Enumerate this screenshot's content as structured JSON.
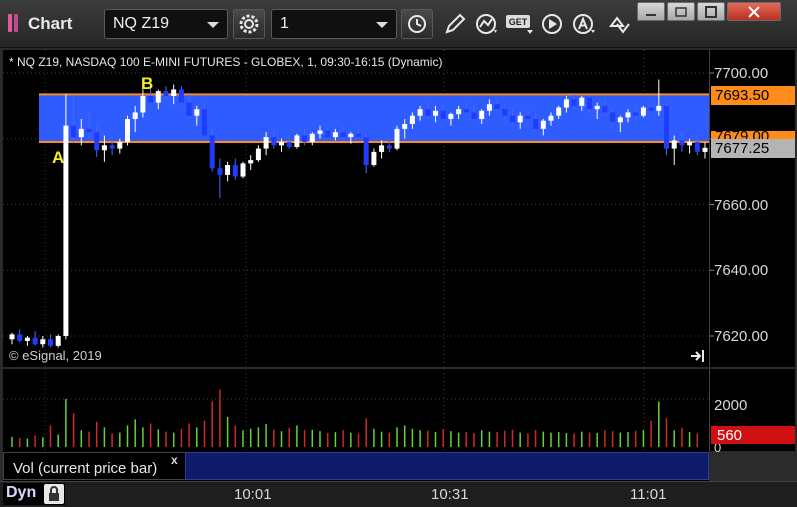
{
  "window": {
    "title": "Chart",
    "symbol": "NQ Z19",
    "interval": "1"
  },
  "chart_info": {
    "header": "* NQ Z19, NASDAQ 100 E-MINI FUTURES - GLOBEX, 1, 09:30-16:15 (Dynamic)",
    "copyright": "© eSignal, 2019",
    "label_a": "A",
    "label_b": "B"
  },
  "colors": {
    "up_candle": "#ffffff",
    "down_candle": "#1f3cff",
    "zone_fill": "#2f5cff",
    "zone_line": "#ff8c1a",
    "current_price_tag": "#b4b4b4",
    "upper_price_tag": "#ff8c1a",
    "volume_up": "#64d23c",
    "volume_down": "#d22828",
    "volume_tag": "#d01010"
  },
  "price_axis": {
    "ticks": [
      "7700.00",
      "7680.00",
      "7660.00",
      "7640.00",
      "7620.00"
    ],
    "upper_zone_tag": "7693.50",
    "lower_zone_tag": "7679.00",
    "current_price_tag": "7677.25"
  },
  "volume_panel": {
    "legend": "Vol (current price bar)",
    "close_symbol": "x",
    "axis_ticks": [
      "2000",
      "0"
    ],
    "current_volume_tag": "560"
  },
  "time_axis": {
    "dyn_label": "Dyn",
    "ticks": [
      "10:01",
      "10:31",
      "11:01"
    ]
  },
  "chart_data": {
    "type": "candlestick",
    "title": "* NQ Z19, NASDAQ 100 E-MINI FUTURES - GLOBEX, 1, 09:30-16:15 (Dynamic)",
    "y_axis_ticks": [
      7620,
      7640,
      7660,
      7680,
      7700
    ],
    "x_axis_ticks": [
      "10:01",
      "10:31",
      "11:01"
    ],
    "ylim": [
      7616,
      7707
    ],
    "zone": {
      "top": 7693.5,
      "bottom": 7679,
      "left_label": "A",
      "right_label": "B"
    },
    "last_price": 7677.25,
    "ohlc": [
      [
        7619.0,
        7621.0,
        7617.5,
        7620.5
      ],
      [
        7620.5,
        7622.0,
        7618.0,
        7618.5
      ],
      [
        7618.5,
        7620.0,
        7617.0,
        7619.5
      ],
      [
        7619.5,
        7621.5,
        7617.0,
        7617.5
      ],
      [
        7617.5,
        7620.0,
        7616.5,
        7619.0
      ],
      [
        7619.0,
        7620.5,
        7616.5,
        7617.0
      ],
      [
        7617.0,
        7620.5,
        7616.5,
        7620.0
      ],
      [
        7620.0,
        7693.5,
        7619.0,
        7684.0
      ],
      [
        7684.0,
        7693.0,
        7679.0,
        7680.5
      ],
      [
        7680.5,
        7686.0,
        7678.0,
        7683.0
      ],
      [
        7683.0,
        7688.0,
        7680.0,
        7682.0
      ],
      [
        7682.0,
        7684.0,
        7674.5,
        7676.5
      ],
      [
        7676.5,
        7681.0,
        7673.0,
        7678.0
      ],
      [
        7678.0,
        7681.0,
        7675.0,
        7677.0
      ],
      [
        7677.0,
        7680.0,
        7675.5,
        7679.0
      ],
      [
        7679.0,
        7687.0,
        7678.0,
        7686.0
      ],
      [
        7686.0,
        7690.0,
        7682.0,
        7688.0
      ],
      [
        7688.0,
        7695.0,
        7686.5,
        7693.0
      ],
      [
        7693.0,
        7697.0,
        7690.0,
        7691.0
      ],
      [
        7691.0,
        7695.0,
        7689.0,
        7694.5
      ],
      [
        7694.5,
        7696.0,
        7692.0,
        7693.0
      ],
      [
        7693.0,
        7696.5,
        7690.5,
        7695.0
      ],
      [
        7695.0,
        7696.0,
        7690.0,
        7691.0
      ],
      [
        7691.0,
        7694.0,
        7686.0,
        7687.0
      ],
      [
        7687.0,
        7690.0,
        7684.0,
        7689.0
      ],
      [
        7689.0,
        7691.0,
        7680.5,
        7681.0
      ],
      [
        7681.0,
        7683.0,
        7670.0,
        7671.0
      ],
      [
        7671.0,
        7674.0,
        7662.0,
        7669.0
      ],
      [
        7669.0,
        7673.0,
        7667.0,
        7672.0
      ],
      [
        7672.0,
        7674.0,
        7667.5,
        7668.5
      ],
      [
        7668.5,
        7673.0,
        7668.0,
        7672.5
      ],
      [
        7672.5,
        7675.0,
        7670.5,
        7673.5
      ],
      [
        7673.5,
        7678.0,
        7673.0,
        7677.0
      ],
      [
        7677.0,
        7682.0,
        7675.0,
        7680.5
      ],
      [
        7680.5,
        7683.0,
        7677.0,
        7678.0
      ],
      [
        7678.0,
        7680.0,
        7676.0,
        7679.0
      ],
      [
        7679.0,
        7681.0,
        7677.0,
        7677.5
      ],
      [
        7677.5,
        7681.5,
        7677.0,
        7681.0
      ],
      [
        7681.0,
        7683.0,
        7678.0,
        7679.0
      ],
      [
        7679.0,
        7682.0,
        7678.0,
        7681.5
      ],
      [
        7681.5,
        7684.0,
        7680.0,
        7682.5
      ],
      [
        7682.5,
        7684.0,
        7680.0,
        7680.5
      ],
      [
        7680.5,
        7683.0,
        7679.5,
        7682.0
      ],
      [
        7682.0,
        7684.0,
        7679.5,
        7680.5
      ],
      [
        7680.5,
        7682.0,
        7678.5,
        7681.5
      ],
      [
        7681.5,
        7683.5,
        7680.0,
        7680.5
      ],
      [
        7680.5,
        7682.0,
        7669.5,
        7672.0
      ],
      [
        7672.0,
        7677.0,
        7671.5,
        7676.0
      ],
      [
        7676.0,
        7679.5,
        7674.0,
        7678.0
      ],
      [
        7678.0,
        7680.0,
        7676.0,
        7677.0
      ],
      [
        7677.0,
        7684.0,
        7676.5,
        7683.0
      ],
      [
        7683.0,
        7686.0,
        7680.0,
        7684.5
      ],
      [
        7684.5,
        7688.0,
        7683.0,
        7687.0
      ],
      [
        7687.0,
        7690.0,
        7685.5,
        7689.0
      ],
      [
        7689.0,
        7691.0,
        7686.0,
        7687.0
      ],
      [
        7687.0,
        7690.0,
        7685.0,
        7688.5
      ],
      [
        7688.5,
        7690.5,
        7685.0,
        7686.0
      ],
      [
        7686.0,
        7688.0,
        7684.0,
        7687.5
      ],
      [
        7687.5,
        7690.0,
        7686.0,
        7689.0
      ],
      [
        7689.0,
        7691.0,
        7687.5,
        7688.0
      ],
      [
        7688.0,
        7690.0,
        7685.0,
        7686.0
      ],
      [
        7686.0,
        7689.0,
        7684.5,
        7688.5
      ],
      [
        7688.5,
        7692.0,
        7687.0,
        7690.5
      ],
      [
        7690.5,
        7692.0,
        7688.0,
        7689.0
      ],
      [
        7689.0,
        7690.5,
        7686.0,
        7687.0
      ],
      [
        7687.0,
        7689.0,
        7684.0,
        7685.0
      ],
      [
        7685.0,
        7688.0,
        7683.0,
        7687.0
      ],
      [
        7687.0,
        7689.0,
        7685.0,
        7686.0
      ],
      [
        7686.0,
        7688.0,
        7682.0,
        7683.0
      ],
      [
        7683.0,
        7686.0,
        7681.0,
        7685.5
      ],
      [
        7685.5,
        7688.0,
        7684.0,
        7687.0
      ],
      [
        7687.0,
        7690.0,
        7686.0,
        7689.5
      ],
      [
        7689.5,
        7693.0,
        7688.0,
        7692.0
      ],
      [
        7692.0,
        7694.0,
        7689.0,
        7690.0
      ],
      [
        7690.0,
        7693.0,
        7688.5,
        7692.5
      ],
      [
        7692.5,
        7693.0,
        7688.0,
        7689.0
      ],
      [
        7689.0,
        7691.0,
        7686.0,
        7690.0
      ],
      [
        7690.0,
        7692.0,
        7687.0,
        7688.0
      ],
      [
        7688.0,
        7689.5,
        7684.0,
        7685.0
      ],
      [
        7685.0,
        7687.0,
        7682.0,
        7686.5
      ],
      [
        7686.5,
        7689.0,
        7685.0,
        7688.0
      ],
      [
        7688.0,
        7690.0,
        7686.0,
        7687.0
      ],
      [
        7687.0,
        7690.0,
        7686.5,
        7689.5
      ],
      [
        7689.5,
        7691.0,
        7687.5,
        7688.5
      ],
      [
        7688.5,
        7698.0,
        7687.0,
        7690.0
      ],
      [
        7690.0,
        7691.5,
        7675.0,
        7677.0
      ],
      [
        7677.0,
        7681.0,
        7672.0,
        7679.5
      ],
      [
        7679.5,
        7682.0,
        7676.0,
        7678.0
      ],
      [
        7678.0,
        7680.0,
        7675.5,
        7679.0
      ],
      [
        7679.0,
        7681.0,
        7675.0,
        7676.0
      ],
      [
        7676.0,
        7679.0,
        7674.0,
        7677.25
      ]
    ],
    "volume": [
      420,
      380,
      350,
      480,
      400,
      900,
      520,
      2000,
      1400,
      700,
      640,
      1050,
      820,
      560,
      600,
      900,
      1150,
      820,
      980,
      740,
      640,
      600,
      760,
      980,
      820,
      1100,
      1900,
      2400,
      1250,
      900,
      700,
      760,
      820,
      960,
      720,
      660,
      800,
      900,
      700,
      720,
      660,
      580,
      620,
      700,
      600,
      560,
      1200,
      760,
      640,
      600,
      820,
      900,
      760,
      700,
      680,
      620,
      740,
      660,
      600,
      620,
      580,
      700,
      640,
      620,
      680,
      720,
      600,
      560,
      700,
      640,
      600,
      620,
      580,
      560,
      640,
      600,
      580,
      700,
      660,
      600,
      620,
      680,
      700,
      1100,
      1900,
      1200,
      700,
      800,
      620,
      560
    ],
    "volume_axis_ticks": [
      0,
      2000
    ],
    "volume_ylim": [
      0,
      3000
    ]
  }
}
